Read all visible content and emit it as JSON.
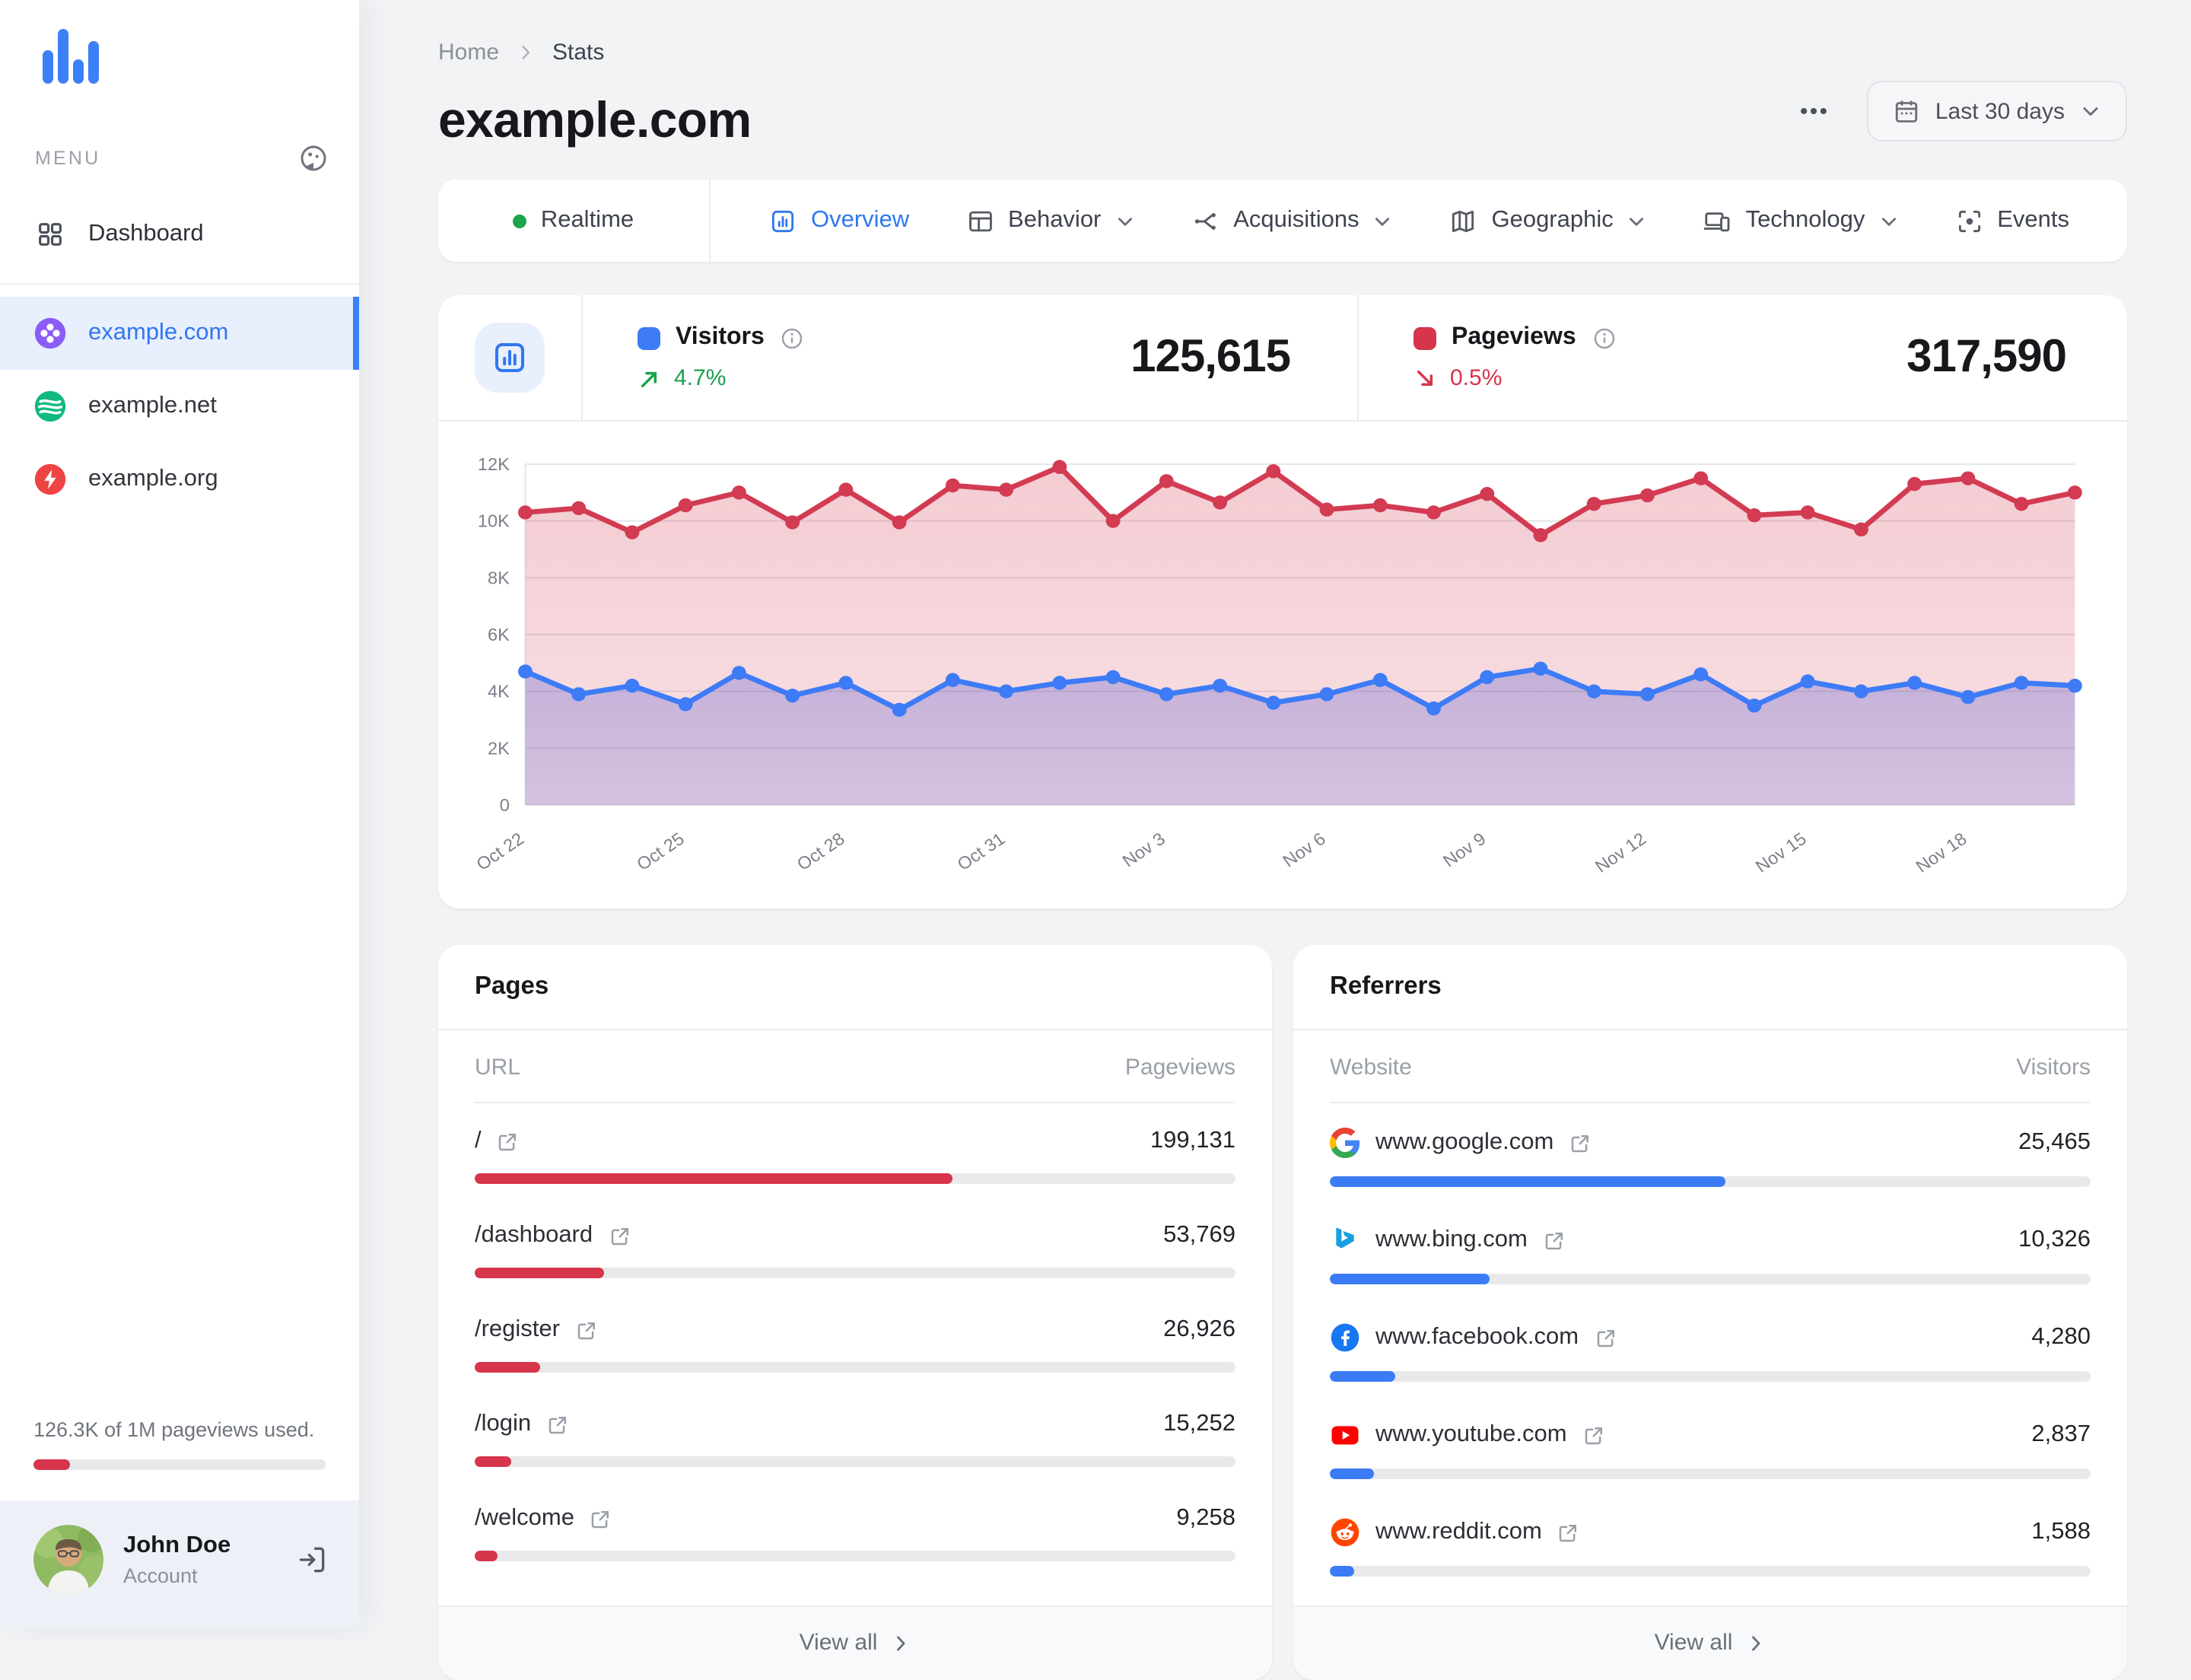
{
  "colors": {
    "accent_blue": "#3277f2",
    "chart_blue": "#3d7bf7",
    "chart_red": "#d23b52",
    "bar_red": "#d6354c",
    "bar_blue": "#3b7cf5",
    "green": "#18a24a",
    "realtime_green": "#1ca44c"
  },
  "sidebar": {
    "menu_label": "MENU",
    "dashboard_label": "Dashboard",
    "sites": [
      {
        "name": "example.com",
        "icon": "clover-site-icon",
        "color": "#8b5cf6",
        "selected": true
      },
      {
        "name": "example.net",
        "icon": "waves-site-icon",
        "color": "#10b981",
        "selected": false
      },
      {
        "name": "example.org",
        "icon": "bolt-site-icon",
        "color": "#ef4444",
        "selected": false
      }
    ],
    "usage_text": "126.3K of 1M pageviews used.",
    "usage_pct": 12.6,
    "user": {
      "name": "John Doe",
      "role": "Account"
    }
  },
  "header": {
    "breadcrumb": {
      "home": "Home",
      "current": "Stats"
    },
    "title": "example.com",
    "date_range": "Last 30 days"
  },
  "tabs": [
    {
      "label": "Realtime",
      "icon": "realtime-dot",
      "kind": "realtime"
    },
    {
      "label": "Overview",
      "icon": "overview-icon",
      "active": true
    },
    {
      "label": "Behavior",
      "icon": "behavior-icon",
      "dropdown": true
    },
    {
      "label": "Acquisitions",
      "icon": "acquisitions-icon",
      "dropdown": true
    },
    {
      "label": "Geographic",
      "icon": "geographic-icon",
      "dropdown": true
    },
    {
      "label": "Technology",
      "icon": "technology-icon",
      "dropdown": true
    },
    {
      "label": "Events",
      "icon": "events-icon"
    }
  ],
  "stats": {
    "visitors": {
      "label": "Visitors",
      "value": "125,615",
      "change": "4.7%",
      "direction": "up"
    },
    "pageviews": {
      "label": "Pageviews",
      "value": "317,590",
      "change": "0.5%",
      "direction": "down"
    }
  },
  "chart_data": {
    "type": "area",
    "title": "",
    "xlabel": "",
    "ylabel": "",
    "ylim": [
      0,
      12000
    ],
    "ytick_step": 2000,
    "ytick_labels": [
      "0",
      "2K",
      "4K",
      "6K",
      "8K",
      "10K",
      "12K"
    ],
    "tick_every": 3,
    "legend_position": "none",
    "grid": true,
    "categories": [
      "Oct 22",
      "Oct 23",
      "Oct 24",
      "Oct 25",
      "Oct 26",
      "Oct 27",
      "Oct 28",
      "Oct 29",
      "Oct 30",
      "Oct 31",
      "Nov 1",
      "Nov 2",
      "Nov 3",
      "Nov 4",
      "Nov 5",
      "Nov 6",
      "Nov 7",
      "Nov 8",
      "Nov 9",
      "Nov 10",
      "Nov 11",
      "Nov 12",
      "Nov 13",
      "Nov 14",
      "Nov 15",
      "Nov 16",
      "Nov 17",
      "Nov 18",
      "Nov 19",
      "Nov 20"
    ],
    "series": [
      {
        "name": "Pageviews",
        "color": "#d23b52",
        "values": [
          10300,
          10450,
          9600,
          10550,
          11000,
          9950,
          11100,
          9950,
          11250,
          11100,
          11900,
          10000,
          11400,
          10650,
          11750,
          10400,
          10550,
          10300,
          10950,
          9500,
          10600,
          10900,
          11500,
          10200,
          10300,
          9700,
          11300,
          11500,
          10600,
          11000
        ]
      },
      {
        "name": "Visitors",
        "color": "#3d7bf7",
        "values": [
          4700,
          3900,
          4200,
          3550,
          4650,
          3850,
          4300,
          3350,
          4400,
          4000,
          4300,
          4500,
          3900,
          4200,
          3600,
          3900,
          4400,
          3400,
          4500,
          4800,
          4000,
          3900,
          4600,
          3500,
          4350,
          4000,
          4300,
          3800,
          4300,
          4200
        ]
      }
    ]
  },
  "pages": {
    "title": "Pages",
    "col_name": "URL",
    "col_value": "Pageviews",
    "bar_color": "#d6354c",
    "view_all": "View all",
    "rows": [
      {
        "label": "/",
        "value": "199,131",
        "pct": 62.7
      },
      {
        "label": "/dashboard",
        "value": "53,769",
        "pct": 16.9
      },
      {
        "label": "/register",
        "value": "26,926",
        "pct": 8.5
      },
      {
        "label": "/login",
        "value": "15,252",
        "pct": 4.8
      },
      {
        "label": "/welcome",
        "value": "9,258",
        "pct": 2.9
      }
    ]
  },
  "referrers": {
    "title": "Referrers",
    "col_name": "Website",
    "col_value": "Visitors",
    "bar_color": "#3b7cf5",
    "view_all": "View all",
    "rows": [
      {
        "label": "www.google.com",
        "favicon": "google-favicon",
        "value": "25,465",
        "pct": 52.0
      },
      {
        "label": "www.bing.com",
        "favicon": "bing-favicon",
        "value": "10,326",
        "pct": 21.0
      },
      {
        "label": "www.facebook.com",
        "favicon": "facebook-favicon",
        "value": "4,280",
        "pct": 8.6
      },
      {
        "label": "www.youtube.com",
        "favicon": "youtube-favicon",
        "value": "2,837",
        "pct": 5.8
      },
      {
        "label": "www.reddit.com",
        "favicon": "reddit-favicon",
        "value": "1,588",
        "pct": 3.2
      }
    ]
  }
}
